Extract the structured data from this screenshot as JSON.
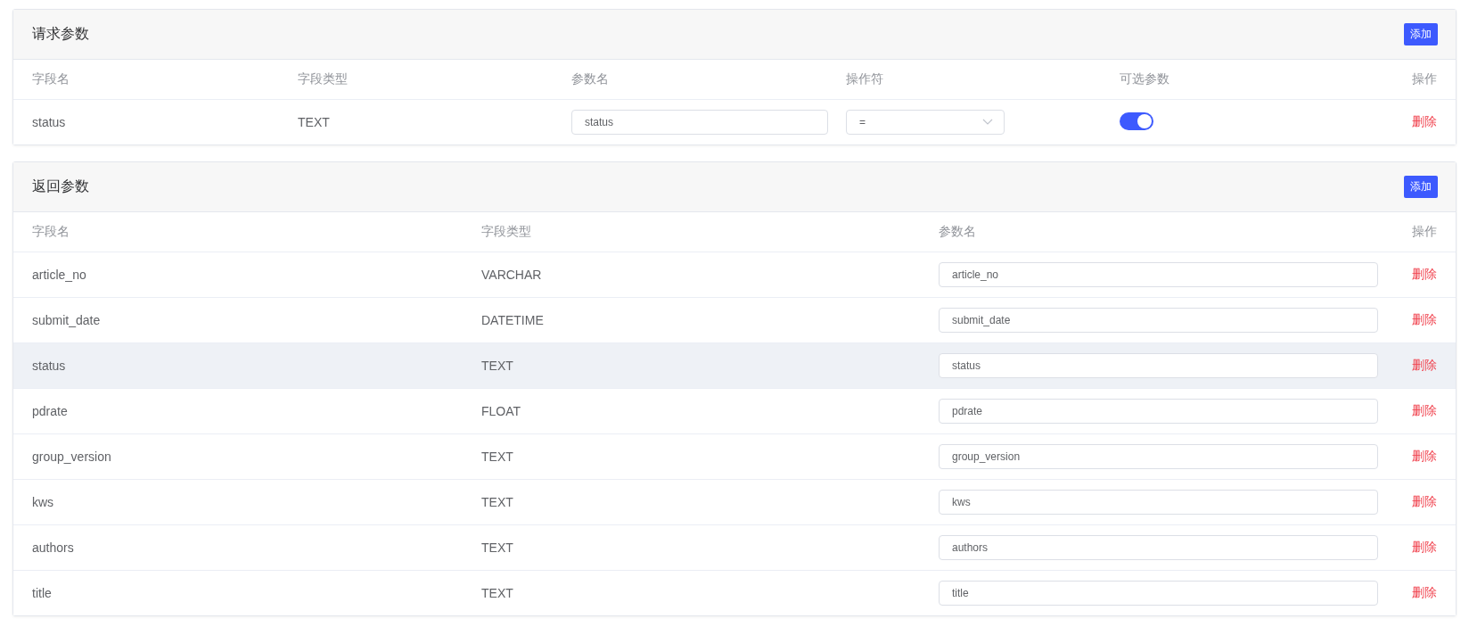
{
  "request_params": {
    "title": "请求参数",
    "add_button": "添加",
    "columns": [
      "字段名",
      "字段类型",
      "参数名",
      "操作符",
      "可选参数",
      "操作"
    ],
    "rows": [
      {
        "field": "status",
        "type": "TEXT",
        "param": "status",
        "operator": "=",
        "optional_on": true,
        "action": "删除"
      }
    ]
  },
  "response_params": {
    "title": "返回参数",
    "add_button": "添加",
    "columns": [
      "字段名",
      "字段类型",
      "参数名",
      "操作"
    ],
    "rows": [
      {
        "field": "article_no",
        "type": "VARCHAR",
        "param": "article_no",
        "action": "删除",
        "highlighted": false
      },
      {
        "field": "submit_date",
        "type": "DATETIME",
        "param": "submit_date",
        "action": "删除",
        "highlighted": false
      },
      {
        "field": "status",
        "type": "TEXT",
        "param": "status",
        "action": "删除",
        "highlighted": true
      },
      {
        "field": "pdrate",
        "type": "FLOAT",
        "param": "pdrate",
        "action": "删除",
        "highlighted": false
      },
      {
        "field": "group_version",
        "type": "TEXT",
        "param": "group_version",
        "action": "删除",
        "highlighted": false
      },
      {
        "field": "kws",
        "type": "TEXT",
        "param": "kws",
        "action": "删除",
        "highlighted": false
      },
      {
        "field": "authors",
        "type": "TEXT",
        "param": "authors",
        "action": "删除",
        "highlighted": false
      },
      {
        "field": "title",
        "type": "TEXT",
        "param": "title",
        "action": "删除",
        "highlighted": false
      }
    ]
  }
}
